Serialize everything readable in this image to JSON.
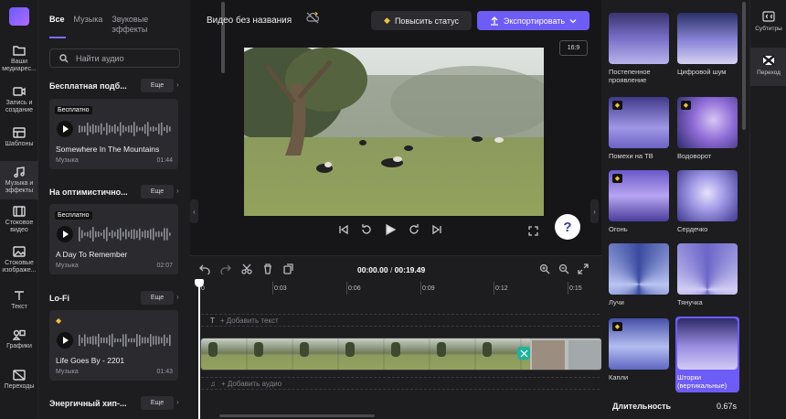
{
  "rail": {
    "items": [
      {
        "label": "Ваши медиарес...",
        "icon": "folder-icon"
      },
      {
        "label": "Запись и создание",
        "icon": "camera-icon"
      },
      {
        "label": "Шаблоны",
        "icon": "templates-icon"
      },
      {
        "label": "Музыка и эффекты",
        "icon": "music-icon"
      },
      {
        "label": "Стоковое видео",
        "icon": "film-icon"
      },
      {
        "label": "Стоковые изображе...",
        "icon": "image-icon"
      },
      {
        "label": "Текст",
        "icon": "text-icon"
      },
      {
        "label": "Графики",
        "icon": "shapes-icon"
      },
      {
        "label": "Переходы",
        "icon": "transitions-icon"
      }
    ]
  },
  "audio_panel": {
    "tabs": [
      "Все",
      "Музыка",
      "Звуковые эффекты"
    ],
    "search_placeholder": "Найти аудио",
    "more_label": "Еще",
    "sections": [
      {
        "title": "Бесплатная подб...",
        "card": {
          "badge": "Бесплатно",
          "name": "Somewhere In The Mountains",
          "genre": "Музыка",
          "duration": "01:44"
        }
      },
      {
        "title": "На оптимистично...",
        "card": {
          "badge": "Бесплатно",
          "name": "A Day To Remember",
          "genre": "Музыка",
          "duration": "02:07"
        }
      },
      {
        "title": "Lo-Fi",
        "card": {
          "badge": "",
          "name": "Life Goes By - 2201",
          "genre": "Музыка",
          "duration": "01:43"
        }
      },
      {
        "title": "Энергичный хип-..."
      }
    ]
  },
  "topbar": {
    "project_title": "Видео без названия",
    "upgrade_label": "Повысить статус",
    "export_label": "Экспортировать"
  },
  "preview": {
    "aspect_ratio": "16:9",
    "help": "?"
  },
  "timeline": {
    "current_time": "00:00.00",
    "total_time": "00:19.49",
    "ruler_labels": [
      "0",
      "0:03",
      "0:06",
      "0:09",
      "0:12",
      "0:15"
    ],
    "add_text_label": "+ Добавить текст",
    "add_audio_label": "+ Добавить аудио"
  },
  "transitions_panel": {
    "tiles": [
      {
        "label": "Постепенное проявление",
        "premium": false
      },
      {
        "label": "Цифровой шум",
        "premium": false
      },
      {
        "label": "Помехи на ТВ",
        "premium": true
      },
      {
        "label": "Водоворот",
        "premium": true
      },
      {
        "label": "Огонь",
        "premium": true
      },
      {
        "label": "Сердечко",
        "premium": false
      },
      {
        "label": "Лучи",
        "premium": false
      },
      {
        "label": "Тянучка",
        "premium": false
      },
      {
        "label": "Капли",
        "premium": true
      },
      {
        "label": "Шторки (вертикальные)",
        "premium": false
      }
    ],
    "selected": "Шторки (вертикальные)",
    "duration_label": "Длительность",
    "duration_value": "0.67s"
  },
  "right_rail": {
    "items": [
      {
        "label": "Субтитры",
        "icon": "captions-icon"
      },
      {
        "label": "Переход",
        "icon": "transition-icon"
      }
    ]
  },
  "colors": {
    "accent": "#6d5cf5",
    "background": "#161618",
    "panel": "#1d1d20",
    "transition_marker": "#1fb29a",
    "premium": "#f0c040"
  }
}
